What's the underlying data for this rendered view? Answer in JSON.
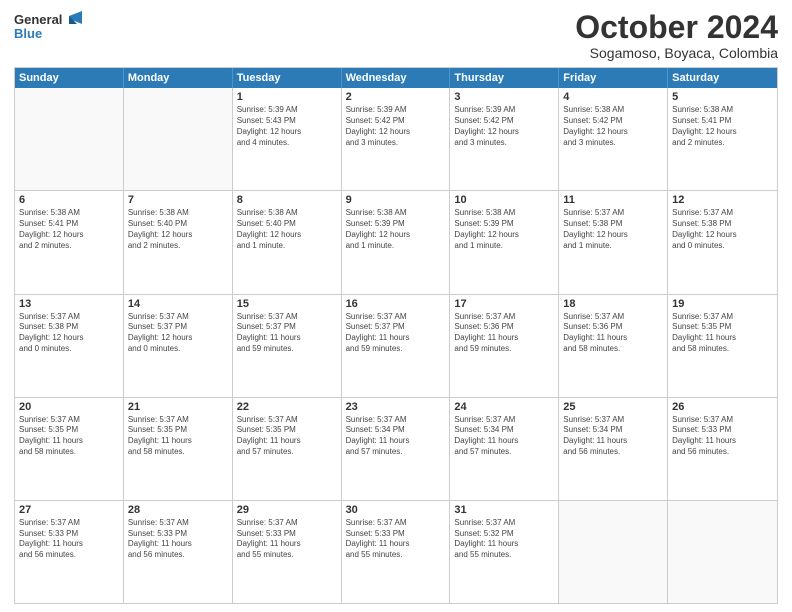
{
  "header": {
    "logo_line1": "General",
    "logo_line2": "Blue",
    "month": "October 2024",
    "location": "Sogamoso, Boyaca, Colombia"
  },
  "weekdays": [
    "Sunday",
    "Monday",
    "Tuesday",
    "Wednesday",
    "Thursday",
    "Friday",
    "Saturday"
  ],
  "rows": [
    [
      {
        "day": "",
        "info": ""
      },
      {
        "day": "",
        "info": ""
      },
      {
        "day": "1",
        "info": "Sunrise: 5:39 AM\nSunset: 5:43 PM\nDaylight: 12 hours\nand 4 minutes."
      },
      {
        "day": "2",
        "info": "Sunrise: 5:39 AM\nSunset: 5:42 PM\nDaylight: 12 hours\nand 3 minutes."
      },
      {
        "day": "3",
        "info": "Sunrise: 5:39 AM\nSunset: 5:42 PM\nDaylight: 12 hours\nand 3 minutes."
      },
      {
        "day": "4",
        "info": "Sunrise: 5:38 AM\nSunset: 5:42 PM\nDaylight: 12 hours\nand 3 minutes."
      },
      {
        "day": "5",
        "info": "Sunrise: 5:38 AM\nSunset: 5:41 PM\nDaylight: 12 hours\nand 2 minutes."
      }
    ],
    [
      {
        "day": "6",
        "info": "Sunrise: 5:38 AM\nSunset: 5:41 PM\nDaylight: 12 hours\nand 2 minutes."
      },
      {
        "day": "7",
        "info": "Sunrise: 5:38 AM\nSunset: 5:40 PM\nDaylight: 12 hours\nand 2 minutes."
      },
      {
        "day": "8",
        "info": "Sunrise: 5:38 AM\nSunset: 5:40 PM\nDaylight: 12 hours\nand 1 minute."
      },
      {
        "day": "9",
        "info": "Sunrise: 5:38 AM\nSunset: 5:39 PM\nDaylight: 12 hours\nand 1 minute."
      },
      {
        "day": "10",
        "info": "Sunrise: 5:38 AM\nSunset: 5:39 PM\nDaylight: 12 hours\nand 1 minute."
      },
      {
        "day": "11",
        "info": "Sunrise: 5:37 AM\nSunset: 5:38 PM\nDaylight: 12 hours\nand 1 minute."
      },
      {
        "day": "12",
        "info": "Sunrise: 5:37 AM\nSunset: 5:38 PM\nDaylight: 12 hours\nand 0 minutes."
      }
    ],
    [
      {
        "day": "13",
        "info": "Sunrise: 5:37 AM\nSunset: 5:38 PM\nDaylight: 12 hours\nand 0 minutes."
      },
      {
        "day": "14",
        "info": "Sunrise: 5:37 AM\nSunset: 5:37 PM\nDaylight: 12 hours\nand 0 minutes."
      },
      {
        "day": "15",
        "info": "Sunrise: 5:37 AM\nSunset: 5:37 PM\nDaylight: 11 hours\nand 59 minutes."
      },
      {
        "day": "16",
        "info": "Sunrise: 5:37 AM\nSunset: 5:37 PM\nDaylight: 11 hours\nand 59 minutes."
      },
      {
        "day": "17",
        "info": "Sunrise: 5:37 AM\nSunset: 5:36 PM\nDaylight: 11 hours\nand 59 minutes."
      },
      {
        "day": "18",
        "info": "Sunrise: 5:37 AM\nSunset: 5:36 PM\nDaylight: 11 hours\nand 58 minutes."
      },
      {
        "day": "19",
        "info": "Sunrise: 5:37 AM\nSunset: 5:35 PM\nDaylight: 11 hours\nand 58 minutes."
      }
    ],
    [
      {
        "day": "20",
        "info": "Sunrise: 5:37 AM\nSunset: 5:35 PM\nDaylight: 11 hours\nand 58 minutes."
      },
      {
        "day": "21",
        "info": "Sunrise: 5:37 AM\nSunset: 5:35 PM\nDaylight: 11 hours\nand 58 minutes."
      },
      {
        "day": "22",
        "info": "Sunrise: 5:37 AM\nSunset: 5:35 PM\nDaylight: 11 hours\nand 57 minutes."
      },
      {
        "day": "23",
        "info": "Sunrise: 5:37 AM\nSunset: 5:34 PM\nDaylight: 11 hours\nand 57 minutes."
      },
      {
        "day": "24",
        "info": "Sunrise: 5:37 AM\nSunset: 5:34 PM\nDaylight: 11 hours\nand 57 minutes."
      },
      {
        "day": "25",
        "info": "Sunrise: 5:37 AM\nSunset: 5:34 PM\nDaylight: 11 hours\nand 56 minutes."
      },
      {
        "day": "26",
        "info": "Sunrise: 5:37 AM\nSunset: 5:33 PM\nDaylight: 11 hours\nand 56 minutes."
      }
    ],
    [
      {
        "day": "27",
        "info": "Sunrise: 5:37 AM\nSunset: 5:33 PM\nDaylight: 11 hours\nand 56 minutes."
      },
      {
        "day": "28",
        "info": "Sunrise: 5:37 AM\nSunset: 5:33 PM\nDaylight: 11 hours\nand 56 minutes."
      },
      {
        "day": "29",
        "info": "Sunrise: 5:37 AM\nSunset: 5:33 PM\nDaylight: 11 hours\nand 55 minutes."
      },
      {
        "day": "30",
        "info": "Sunrise: 5:37 AM\nSunset: 5:33 PM\nDaylight: 11 hours\nand 55 minutes."
      },
      {
        "day": "31",
        "info": "Sunrise: 5:37 AM\nSunset: 5:32 PM\nDaylight: 11 hours\nand 55 minutes."
      },
      {
        "day": "",
        "info": ""
      },
      {
        "day": "",
        "info": ""
      }
    ]
  ]
}
